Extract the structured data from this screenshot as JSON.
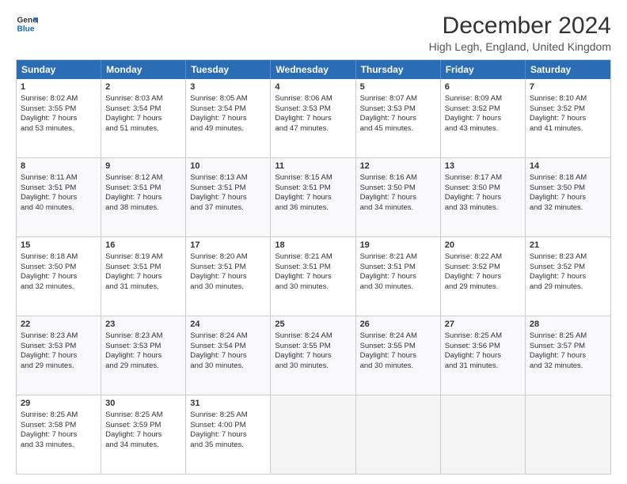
{
  "logo": {
    "line1": "General",
    "line2": "Blue"
  },
  "title": "December 2024",
  "subtitle": "High Legh, England, United Kingdom",
  "days": [
    "Sunday",
    "Monday",
    "Tuesday",
    "Wednesday",
    "Thursday",
    "Friday",
    "Saturday"
  ],
  "weeks": [
    [
      {
        "day": "1",
        "sunrise": "8:02 AM",
        "sunset": "3:55 PM",
        "daylight": "7 hours and 53 minutes."
      },
      {
        "day": "2",
        "sunrise": "8:03 AM",
        "sunset": "3:54 PM",
        "daylight": "7 hours and 51 minutes."
      },
      {
        "day": "3",
        "sunrise": "8:05 AM",
        "sunset": "3:54 PM",
        "daylight": "7 hours and 49 minutes."
      },
      {
        "day": "4",
        "sunrise": "8:06 AM",
        "sunset": "3:53 PM",
        "daylight": "7 hours and 47 minutes."
      },
      {
        "day": "5",
        "sunrise": "8:07 AM",
        "sunset": "3:53 PM",
        "daylight": "7 hours and 45 minutes."
      },
      {
        "day": "6",
        "sunrise": "8:09 AM",
        "sunset": "3:52 PM",
        "daylight": "7 hours and 43 minutes."
      },
      {
        "day": "7",
        "sunrise": "8:10 AM",
        "sunset": "3:52 PM",
        "daylight": "7 hours and 41 minutes."
      }
    ],
    [
      {
        "day": "8",
        "sunrise": "8:11 AM",
        "sunset": "3:51 PM",
        "daylight": "7 hours and 40 minutes."
      },
      {
        "day": "9",
        "sunrise": "8:12 AM",
        "sunset": "3:51 PM",
        "daylight": "7 hours and 38 minutes."
      },
      {
        "day": "10",
        "sunrise": "8:13 AM",
        "sunset": "3:51 PM",
        "daylight": "7 hours and 37 minutes."
      },
      {
        "day": "11",
        "sunrise": "8:15 AM",
        "sunset": "3:51 PM",
        "daylight": "7 hours and 36 minutes."
      },
      {
        "day": "12",
        "sunrise": "8:16 AM",
        "sunset": "3:50 PM",
        "daylight": "7 hours and 34 minutes."
      },
      {
        "day": "13",
        "sunrise": "8:17 AM",
        "sunset": "3:50 PM",
        "daylight": "7 hours and 33 minutes."
      },
      {
        "day": "14",
        "sunrise": "8:18 AM",
        "sunset": "3:50 PM",
        "daylight": "7 hours and 32 minutes."
      }
    ],
    [
      {
        "day": "15",
        "sunrise": "8:18 AM",
        "sunset": "3:50 PM",
        "daylight": "7 hours and 32 minutes."
      },
      {
        "day": "16",
        "sunrise": "8:19 AM",
        "sunset": "3:51 PM",
        "daylight": "7 hours and 31 minutes."
      },
      {
        "day": "17",
        "sunrise": "8:20 AM",
        "sunset": "3:51 PM",
        "daylight": "7 hours and 30 minutes."
      },
      {
        "day": "18",
        "sunrise": "8:21 AM",
        "sunset": "3:51 PM",
        "daylight": "7 hours and 30 minutes."
      },
      {
        "day": "19",
        "sunrise": "8:21 AM",
        "sunset": "3:51 PM",
        "daylight": "7 hours and 30 minutes."
      },
      {
        "day": "20",
        "sunrise": "8:22 AM",
        "sunset": "3:52 PM",
        "daylight": "7 hours and 29 minutes."
      },
      {
        "day": "21",
        "sunrise": "8:23 AM",
        "sunset": "3:52 PM",
        "daylight": "7 hours and 29 minutes."
      }
    ],
    [
      {
        "day": "22",
        "sunrise": "8:23 AM",
        "sunset": "3:53 PM",
        "daylight": "7 hours and 29 minutes."
      },
      {
        "day": "23",
        "sunrise": "8:23 AM",
        "sunset": "3:53 PM",
        "daylight": "7 hours and 29 minutes."
      },
      {
        "day": "24",
        "sunrise": "8:24 AM",
        "sunset": "3:54 PM",
        "daylight": "7 hours and 30 minutes."
      },
      {
        "day": "25",
        "sunrise": "8:24 AM",
        "sunset": "3:55 PM",
        "daylight": "7 hours and 30 minutes."
      },
      {
        "day": "26",
        "sunrise": "8:24 AM",
        "sunset": "3:55 PM",
        "daylight": "7 hours and 30 minutes."
      },
      {
        "day": "27",
        "sunrise": "8:25 AM",
        "sunset": "3:56 PM",
        "daylight": "7 hours and 31 minutes."
      },
      {
        "day": "28",
        "sunrise": "8:25 AM",
        "sunset": "3:57 PM",
        "daylight": "7 hours and 32 minutes."
      }
    ],
    [
      {
        "day": "29",
        "sunrise": "8:25 AM",
        "sunset": "3:58 PM",
        "daylight": "7 hours and 33 minutes."
      },
      {
        "day": "30",
        "sunrise": "8:25 AM",
        "sunset": "3:59 PM",
        "daylight": "7 hours and 34 minutes."
      },
      {
        "day": "31",
        "sunrise": "8:25 AM",
        "sunset": "4:00 PM",
        "daylight": "7 hours and 35 minutes."
      },
      null,
      null,
      null,
      null
    ]
  ],
  "labels": {
    "sunrise": "Sunrise:",
    "sunset": "Sunset:",
    "daylight": "Daylight:"
  }
}
